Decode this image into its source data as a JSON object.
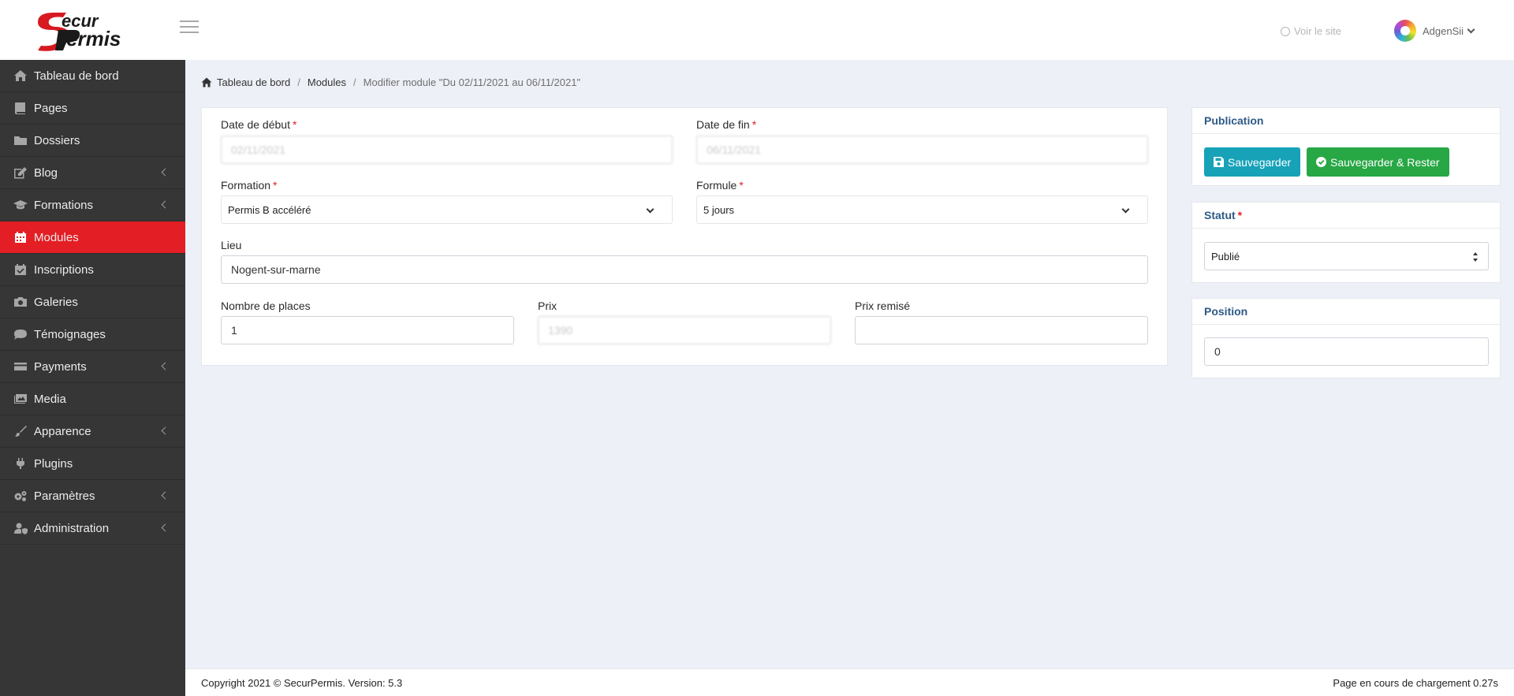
{
  "header": {
    "logo_text": "SecurPermis",
    "visit_site": "Voir le site",
    "user_name": "AdgenSii"
  },
  "sidebar": {
    "items": [
      {
        "label": "Tableau de bord",
        "icon": "home-icon"
      },
      {
        "label": "Pages",
        "icon": "book-icon"
      },
      {
        "label": "Dossiers",
        "icon": "folder-icon"
      },
      {
        "label": "Blog",
        "icon": "edit-icon",
        "has_children": true
      },
      {
        "label": "Formations",
        "icon": "graduation-cap-icon",
        "has_children": true
      },
      {
        "label": "Modules",
        "icon": "calendar-icon",
        "active": true
      },
      {
        "label": "Inscriptions",
        "icon": "calendar-check-icon"
      },
      {
        "label": "Galeries",
        "icon": "camera-icon"
      },
      {
        "label": "Témoignages",
        "icon": "comment-icon"
      },
      {
        "label": "Payments",
        "icon": "credit-card-icon",
        "has_children": true
      },
      {
        "label": "Media",
        "icon": "images-icon"
      },
      {
        "label": "Apparence",
        "icon": "paint-brush-icon",
        "has_children": true
      },
      {
        "label": "Plugins",
        "icon": "plug-icon"
      },
      {
        "label": "Paramètres",
        "icon": "cogs-icon",
        "has_children": true
      },
      {
        "label": "Administration",
        "icon": "user-shield-icon",
        "has_children": true
      }
    ]
  },
  "breadcrumb": {
    "home": "Tableau de bord",
    "modules": "Modules",
    "current": "Modifier module \"Du 02/11/2021 au 06/11/2021\""
  },
  "form": {
    "date_debut": {
      "label": "Date de début",
      "value": "02/11/2021"
    },
    "date_fin": {
      "label": "Date de fin",
      "value": "06/11/2021"
    },
    "formation": {
      "label": "Formation",
      "value": "Permis B accéléré"
    },
    "formule": {
      "label": "Formule",
      "value": "5 jours"
    },
    "lieu": {
      "label": "Lieu",
      "value": "Nogent-sur-marne"
    },
    "nombre_places": {
      "label": "Nombre de places",
      "value": "1"
    },
    "prix": {
      "label": "Prix",
      "value": "1390"
    },
    "prix_remise": {
      "label": "Prix remisé",
      "value": ""
    },
    "required_mark": "*"
  },
  "publication": {
    "title": "Publication",
    "save": "Sauvegarder",
    "save_stay": "Sauvegarder & Rester"
  },
  "statut": {
    "title": "Statut",
    "value": "Publié"
  },
  "position": {
    "title": "Position",
    "value": "0"
  },
  "footer": {
    "copyright": "Copyright 2021 © SecurPermis. Version: 5.3",
    "loading": "Page en cours de chargement 0.27s"
  },
  "colors": {
    "sidebar_bg": "#363636",
    "active_item": "#e31e24",
    "btn_info": "#17a2b8",
    "btn_success": "#28a745",
    "side_title": "#2e5a86"
  }
}
